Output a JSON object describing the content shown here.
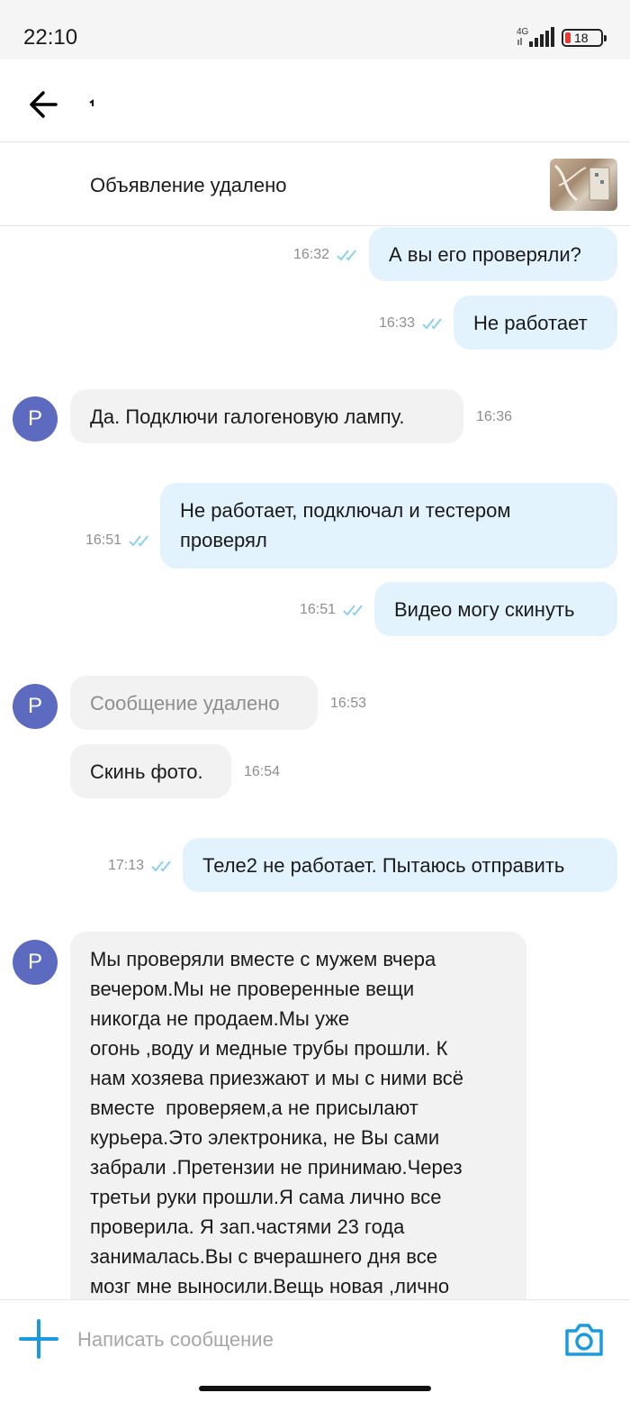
{
  "status_bar": {
    "time": "22:10",
    "network": "4G",
    "battery": "18"
  },
  "header": {
    "back_icon": "arrow-left-icon"
  },
  "listing": {
    "text": "Объявление удалено"
  },
  "messages": [
    {
      "side": "out",
      "text": "А вы его проверяли?",
      "time": "16:32",
      "status": "read"
    },
    {
      "side": "out",
      "text": "Не работает",
      "time": "16:33",
      "status": "read"
    },
    {
      "side": "in",
      "avatar": "Р",
      "text": "Да. Подключи галогеновую лампу.",
      "time": "16:36"
    },
    {
      "side": "out",
      "text": "Не работает, подключал и тестером проверял",
      "time": "16:51",
      "status": "read"
    },
    {
      "side": "out",
      "text": "Видео могу скинуть",
      "time": "16:51",
      "status": "read"
    },
    {
      "side": "in",
      "avatar": "Р",
      "text": "Сообщение удалено",
      "time": "16:53",
      "deleted": true
    },
    {
      "side": "in",
      "text": "Скинь фото.",
      "time": "16:54"
    },
    {
      "side": "out",
      "text": "Теле2 не работает. Пытаюсь отправить",
      "time": "17:13",
      "status": "read"
    },
    {
      "side": "in",
      "avatar": "Р",
      "lines": [
        "Мы проверяли вместе с мужем вчера",
        "вечером.Мы не проверенные вещи",
        "никогда не продаем.Мы уже",
        "огонь ,воду и медные трубы прошли. К",
        "нам хозяева приезжают и мы с ними всё",
        "вместе  проверяем,а не присылают",
        "курьера.Это электроника, не Вы сами",
        "забрали .Претензии не принимаю.Через",
        "третьи руки прошли.Я сама лично все",
        "проверила. Я зап.частями 23 года",
        "занималась.Вы с вчерашнего дня все",
        "мозг мне выносили.Вещь новая ,лично"
      ]
    }
  ],
  "composer": {
    "placeholder": "Написать сообщение",
    "plus_icon": "plus-icon",
    "camera_icon": "camera-icon"
  },
  "colors": {
    "accent": "#1a9be0",
    "outgoing_bubble": "#e3f3fd",
    "incoming_bubble": "#f2f2f2",
    "avatar": "#5c6bc0",
    "ticks": "#8ecfee"
  }
}
